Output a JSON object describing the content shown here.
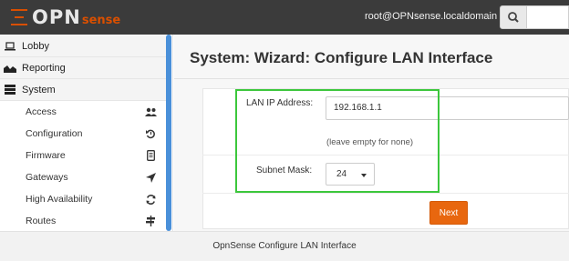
{
  "header": {
    "logo_text": "OPN",
    "logo_suffix": "sense",
    "user": "root@OPNsense.localdomain"
  },
  "sidebar": {
    "top_items": [
      {
        "label": "Lobby",
        "icon": "laptop-icon"
      },
      {
        "label": "Reporting",
        "icon": "area-chart-icon"
      },
      {
        "label": "System",
        "icon": "server-icon"
      }
    ],
    "system_items": [
      {
        "label": "Access",
        "icon": "users-icon"
      },
      {
        "label": "Configuration",
        "icon": "history-icon"
      },
      {
        "label": "Firmware",
        "icon": "tablet-icon"
      },
      {
        "label": "Gateways",
        "icon": "location-arrow-icon"
      },
      {
        "label": "High Availability",
        "icon": "refresh-icon"
      },
      {
        "label": "Routes",
        "icon": "map-signs-icon"
      }
    ]
  },
  "main": {
    "title": "System: Wizard: Configure LAN Interface",
    "lan_ip_label": "LAN IP Address:",
    "lan_ip_value": "192.168.1.1",
    "lan_ip_hint": "(leave empty for none)",
    "subnet_label": "Subnet Mask:",
    "subnet_value": "24",
    "next_label": "Next"
  },
  "caption": "OpnSense Configure LAN Interface",
  "colors": {
    "brand_orange": "#d94f00",
    "button_orange": "#e8670f",
    "highlight_green": "#3cc73c",
    "scrollbar_blue": "#4a90d9"
  }
}
